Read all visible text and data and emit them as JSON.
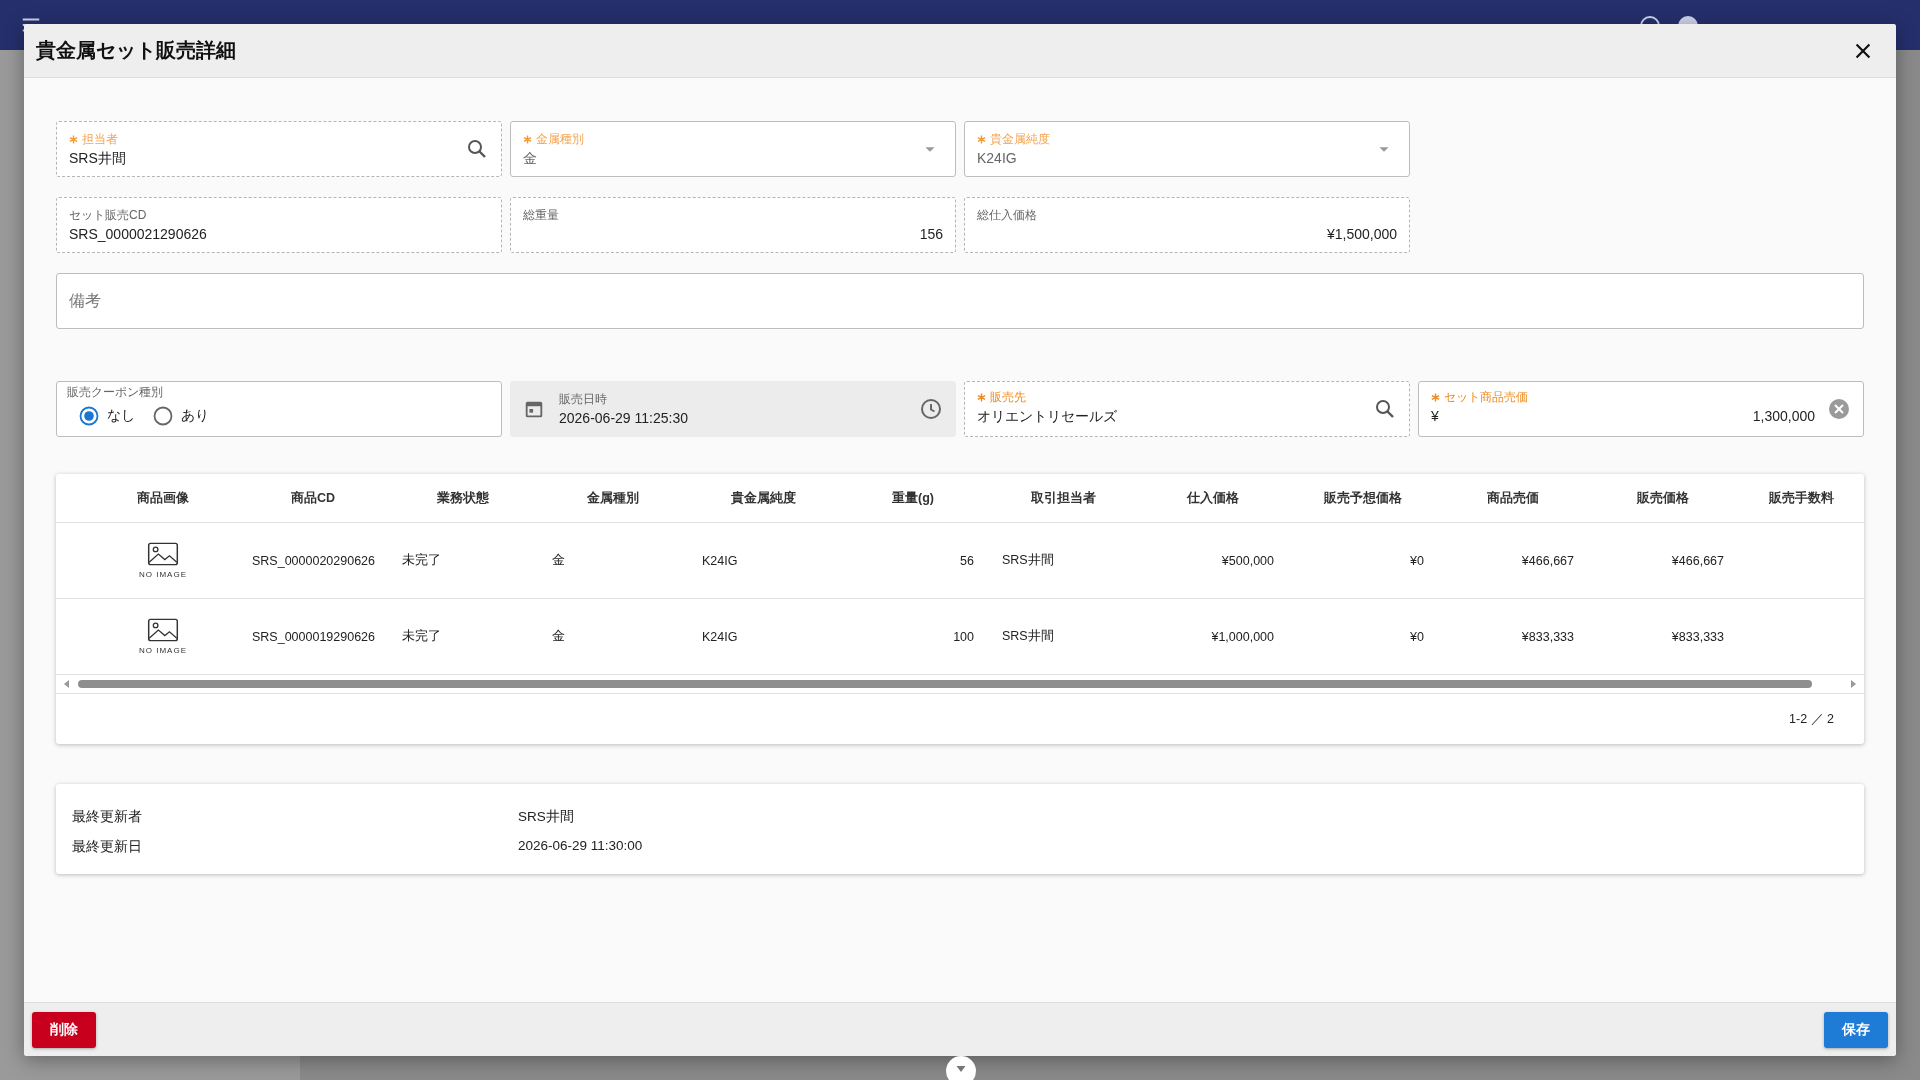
{
  "dialog": {
    "title": "貴金属セット販売詳細"
  },
  "top_fields": [
    {
      "kind": "search",
      "label": "担当者",
      "value": "SRS井間",
      "required": true
    },
    {
      "kind": "select",
      "label": "金属種別",
      "value": "金",
      "required": true
    },
    {
      "kind": "select",
      "label": "貴金属純度",
      "value": "K24IG",
      "required": true
    },
    {
      "kind": "readonly",
      "label": "セット販売CD",
      "value": "SRS_0000021290626",
      "required": false
    },
    {
      "kind": "readonly_number",
      "label": "総重量",
      "value": "156",
      "required": false
    },
    {
      "kind": "readonly_number",
      "label": "総仕入価格",
      "value": "¥1,500,000",
      "required": false
    }
  ],
  "remarks": {
    "placeholder": "備考"
  },
  "coupon": {
    "label": "販売クーポン種別",
    "options": [
      {
        "label": "なし",
        "selected": true
      },
      {
        "label": "あり",
        "selected": false
      }
    ]
  },
  "sale_fields": [
    {
      "kind": "datetime",
      "label": "販売日時",
      "value": "2026-06-29 11:25:30",
      "required": false
    },
    {
      "kind": "search",
      "label": "販売先",
      "value": "オリエントリセールズ",
      "required": true
    },
    {
      "kind": "price",
      "label": "セット商品売価",
      "prefix": "¥",
      "value": "1,300,000",
      "required": true
    }
  ],
  "table": {
    "columns": [
      "商品画像",
      "商品CD",
      "業務状態",
      "金属種別",
      "貴金属純度",
      "重量(g)",
      "取引担当者",
      "仕入価格",
      "販売予想価格",
      "商品売価",
      "販売価格",
      "販売手数料"
    ],
    "rows": [
      {
        "cells": [
          "NO IMAGE",
          "SRS_0000020290626",
          "未完了",
          "金",
          "K24IG",
          "56",
          "SRS井間",
          "¥500,000",
          "¥0",
          "¥466,667",
          "¥466,667"
        ]
      },
      {
        "cells": [
          "NO IMAGE",
          "SRS_0000019290626",
          "未完了",
          "金",
          "K24IG",
          "100",
          "SRS井間",
          "¥1,000,000",
          "¥0",
          "¥833,333",
          "¥833,333"
        ]
      }
    ],
    "pagination": "1-2 ／ 2"
  },
  "info": [
    {
      "label": "最終更新者",
      "value": "SRS井間"
    },
    {
      "label": "最終更新日",
      "value": "2026-06-29 11:30:00"
    }
  ],
  "buttons": {
    "delete": "削除",
    "save": "保存"
  }
}
